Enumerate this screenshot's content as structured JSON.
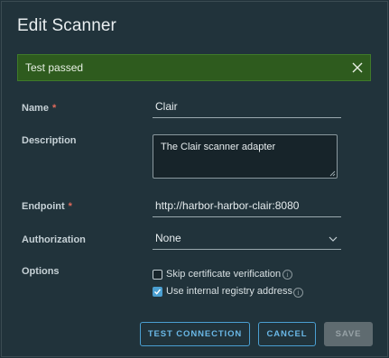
{
  "dialog": {
    "title": "Edit Scanner",
    "alert": {
      "text": "Test passed",
      "close_icon": "close-icon"
    },
    "fields": {
      "name": {
        "label": "Name",
        "required": "*",
        "value": "Clair"
      },
      "description": {
        "label": "Description",
        "value": "The Clair scanner adapter"
      },
      "endpoint": {
        "label": "Endpoint",
        "required": "*",
        "value": "http://harbor-harbor-clair:8080"
      },
      "authorization": {
        "label": "Authorization",
        "value": "None"
      },
      "options": {
        "label": "Options",
        "skip_cert": {
          "label": "Skip certificate verification",
          "checked": false
        },
        "internal_registry": {
          "label": "Use internal registry address",
          "checked": true
        }
      }
    },
    "buttons": {
      "test_connection": "TEST CONNECTION",
      "cancel": "CANCEL",
      "save": "SAVE"
    }
  },
  "colors": {
    "background": "#21333b",
    "success": "#2e5b1e",
    "accent": "#4a9fd1",
    "required": "#e06a5b"
  }
}
